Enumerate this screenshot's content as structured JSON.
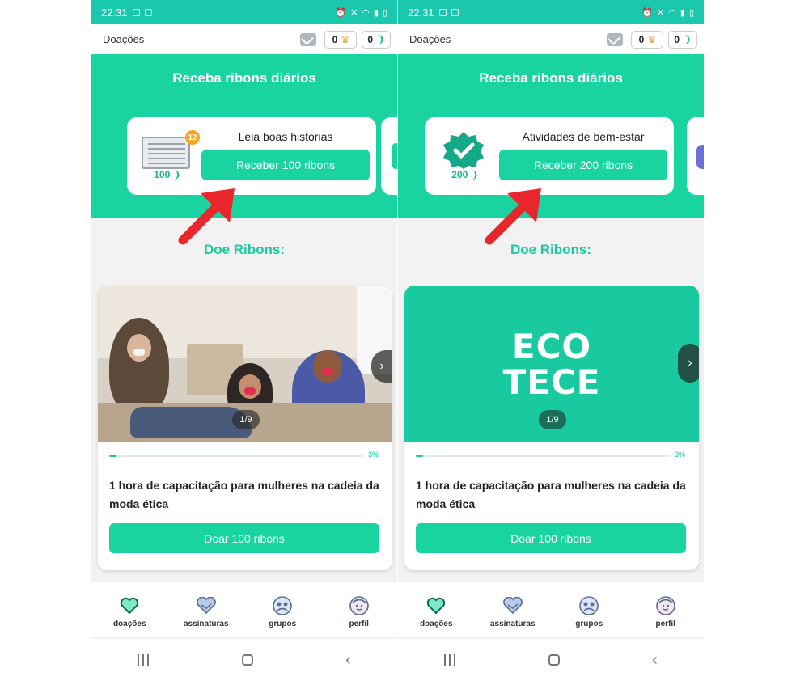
{
  "screens": [
    {
      "status": {
        "time": "22:31"
      },
      "topbar": {
        "title": "Doações",
        "counter_a": "0",
        "counter_b": "0"
      },
      "hero": {
        "title": "Receba ribons diários"
      },
      "task": {
        "label": "Leia boas histórias",
        "button": "Receber 100 ribons",
        "reward": "100",
        "badge": "12"
      },
      "section": {
        "title": "Doe Ribons:"
      },
      "project": {
        "pager": "1/9",
        "progress_pct": "3%",
        "progress_value": 0.03,
        "title": "1 hora de capacitação para mulheres na cadeia da moda ética",
        "donate": "Doar 100 ribons"
      }
    },
    {
      "status": {
        "time": "22:31"
      },
      "topbar": {
        "title": "Doações",
        "counter_a": "0",
        "counter_b": "0"
      },
      "hero": {
        "title": "Receba ribons diários"
      },
      "task": {
        "label": "Atividades de bem-estar",
        "button": "Receber 200 ribons",
        "reward": "200"
      },
      "section": {
        "title": "Doe Ribons:"
      },
      "project": {
        "logo_line1": "ECO",
        "logo_line2": "TECE",
        "pager": "1/9",
        "progress_pct": "3%",
        "progress_value": 0.03,
        "title": "1 hora de capacitação para mulheres na cadeia da moda ética",
        "donate": "Doar 100 ribons"
      }
    }
  ],
  "nav": {
    "donations": "doações",
    "subscriptions": "assinaturas",
    "groups": "grupos",
    "profile": "perfil"
  },
  "colors": {
    "accent": "#19d4a0",
    "status_bar": "#19c8ad",
    "annotation_arrow": "#e8262b",
    "badge": "#f5a623"
  },
  "icons": [
    "newspaper-icon",
    "seal-check-icon",
    "heart-icon",
    "handshake-icon",
    "group-icon",
    "profile-icon",
    "mail-icon",
    "arrow-annotation-icon"
  ]
}
